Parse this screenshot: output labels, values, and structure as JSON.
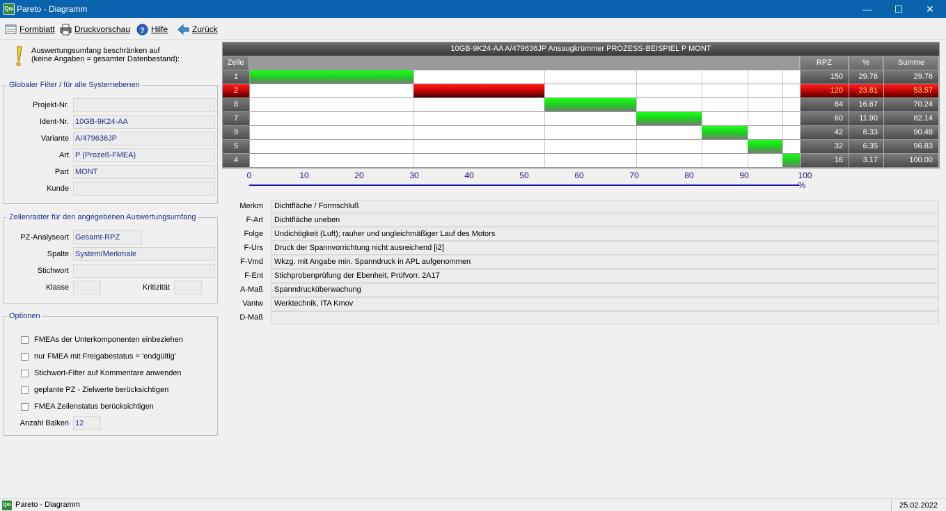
{
  "window": {
    "title": "Pareto - Diagramm",
    "app_icon": "Qm",
    "minimize": "—",
    "maximize": "☐",
    "close": "✕"
  },
  "toolbar": {
    "formblatt": "Formblatt",
    "druckvorschau": "Druckvorschau",
    "hilfe": "Hilfe",
    "zurueck": "Zurück"
  },
  "hint": {
    "line1": "Auswertungsumfang beschränken auf",
    "line2": "(keine Angaben = gesamter Datenbestand):"
  },
  "global_filter": {
    "legend": "Globaler Filter / für alle Systemebenen",
    "fields": [
      {
        "label": "Projekt-Nr.",
        "value": ""
      },
      {
        "label": "Ident-Nr.",
        "value": "10GB-9K24-AA"
      },
      {
        "label": "Variante",
        "value": "A/479636JP"
      },
      {
        "label": "Art",
        "value": "P (Prozeß-FMEA)"
      },
      {
        "label": "Part",
        "value": "MONT"
      },
      {
        "label": "Kunde",
        "value": ""
      }
    ]
  },
  "row_grid": {
    "legend": "Zeilenraster für den angegebenen Auswertungsumfang",
    "pz_label": "PZ-Analyseart",
    "pz_value": "Gesamt-RPZ",
    "spalte_label": "Spalte",
    "spalte_value": "System/Merkmale",
    "stichwort_label": "Stichwort",
    "stichwort_value": "",
    "klasse_label": "Klasse",
    "klasse_value": "",
    "kritizitaet_label": "Kritizität",
    "kritizitaet_value": ""
  },
  "options": {
    "legend": "Optionen",
    "checkboxes": [
      "FMEAs der Unterkomponenten einbeziehen",
      "nur FMEA mit Freigabestatus = 'endgültig'",
      "Stichwort-Filter auf Kommentare anwenden",
      "geplante PZ - Zielwerte berücksichtigen",
      "FMEA Zeilenstatus berücksichtigen"
    ],
    "anzahl_label": "Anzahl Balken",
    "anzahl_value": "12"
  },
  "pareto": {
    "header": "10GB-9K24-AA  A/479636JP  Ansaugkrümmer PROZESS-BEISPIEL  P  MONT",
    "col_zeile": "Zeile",
    "col_rpz": "RPZ",
    "col_pct": "%",
    "col_sum": "Summe",
    "axis_ticks": [
      "0",
      "10",
      "20",
      "30",
      "40",
      "50",
      "60",
      "70",
      "80",
      "90",
      "100 %"
    ],
    "highlight_color": "#c00000",
    "bar_color": "#22c822"
  },
  "chart_data": {
    "type": "bar",
    "categories": [
      "1",
      "2",
      "8",
      "7",
      "9",
      "5",
      "4"
    ],
    "rpz": [
      150,
      120,
      84,
      60,
      42,
      32,
      16
    ],
    "percent": [
      "29.76",
      "23.81",
      "16.67",
      "11.90",
      "8.33",
      "6.35",
      "3.17"
    ],
    "cumulative": [
      "29.76",
      "53.57",
      "70.24",
      "82.14",
      "90.48",
      "96.83",
      "100.00"
    ],
    "highlighted_row": "2",
    "xlim": [
      0,
      100
    ]
  },
  "details": [
    {
      "label": "Merkm",
      "value": "Dichtfläche / Formschluß"
    },
    {
      "label": "F-Art",
      "value": "Dichtfläche uneben"
    },
    {
      "label": "Folge",
      "value": "Undichtigkeit (Luft); rauher und ungleichmäßiger  Lauf des Motors"
    },
    {
      "label": "F-Urs",
      "value": "Druck der Spannvorrichtung nicht  ausreichend [i2]"
    },
    {
      "label": "F-Vmd",
      "value": "Wkzg. mit Angabe min. Spanndruck in APL  aufgenommen"
    },
    {
      "label": "F-Ent",
      "value": "Stichprobenprüfung der Ebenheit, Prüfvorr. 2A17"
    },
    {
      "label": "A-Maß",
      "value": "Spanndrucküberwachung"
    },
    {
      "label": "Vantw",
      "value": "Werktechnik, ITA Kmov"
    },
    {
      "label": "D-Maß",
      "value": ""
    }
  ],
  "status": {
    "text": "Pareto - Diagramm",
    "date": "25.02.2022"
  }
}
